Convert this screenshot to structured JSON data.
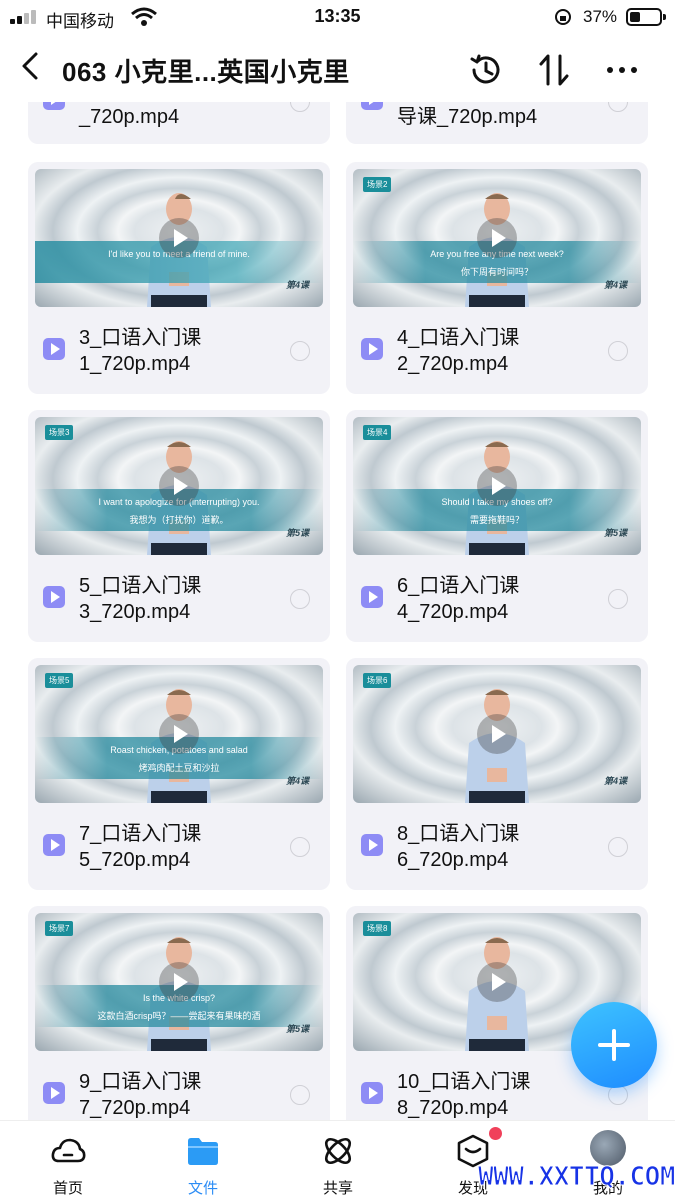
{
  "status_bar": {
    "carrier": "中国移动",
    "time": "13:35",
    "battery_percent_text": "37%",
    "battery_level": 0.37
  },
  "header": {
    "title": "063 小克里...英国小克里",
    "icons": [
      "back-chevron-icon",
      "history-icon",
      "sort-icon",
      "more-icon"
    ]
  },
  "files": [
    {
      "line1": "",
      "line2": "_720p.mp4",
      "partial": true
    },
    {
      "line1": "",
      "line2": "导课_720p.mp4",
      "partial": true
    },
    {
      "line1": "3_口语入门课",
      "line2": "1_720p.mp4",
      "sub_en": "I'd like you to meet a friend of mine.",
      "sub_zh": "",
      "lesson": "第4课",
      "tag": ""
    },
    {
      "line1": "4_口语入门课",
      "line2": "2_720p.mp4",
      "sub_en": "Are you free any time next week?",
      "sub_zh": "你下周有时间吗？",
      "lesson": "第4课",
      "tag": "场景2"
    },
    {
      "line1": "5_口语入门课",
      "line2": "3_720p.mp4",
      "sub_en": "I want to apologize for (interrupting) you.",
      "sub_zh": "我想为（打扰你）道歉。",
      "lesson": "第5课",
      "tag": "场景3"
    },
    {
      "line1": "6_口语入门课",
      "line2": "4_720p.mp4",
      "sub_en": "Should I take my shoes off?",
      "sub_zh": "需要拖鞋吗？",
      "lesson": "第5课",
      "tag": "场景4"
    },
    {
      "line1": "7_口语入门课",
      "line2": "5_720p.mp4",
      "sub_en": "Roast chicken, potatoes and salad",
      "sub_zh": "烤鸡肉配土豆和沙拉",
      "lesson": "第4课",
      "tag": "场景5"
    },
    {
      "line1": "8_口语入门课",
      "line2": "6_720p.mp4",
      "sub_en": "",
      "sub_zh": "",
      "lesson": "第4课",
      "tag": "场景6"
    },
    {
      "line1": "9_口语入门课",
      "line2": "7_720p.mp4",
      "sub_en": "Is the white crisp?",
      "sub_zh": "这款白酒crisp吗？——尝起来有果味的酒",
      "lesson": "第5课",
      "tag": "场景7"
    },
    {
      "line1": "10_口语入门课",
      "line2": "8_720p.mp4",
      "sub_en": "",
      "sub_zh": "",
      "lesson": "",
      "tag": "场景8"
    }
  ],
  "tabs": [
    {
      "label": "首页",
      "icon": "cloud-home-icon",
      "active": false
    },
    {
      "label": "文件",
      "icon": "folder-icon",
      "active": true
    },
    {
      "label": "共享",
      "icon": "share-atom-icon",
      "active": false
    },
    {
      "label": "发现",
      "icon": "discover-box-icon",
      "active": false
    },
    {
      "label": "我的",
      "icon": "avatar-icon",
      "active": false
    }
  ],
  "watermark": "WWW.XXTTQ.COM",
  "colors": {
    "accent": "#2b8cf5",
    "card_bg": "#f2f2f7",
    "file_icon": "#8e8cf5",
    "fab": "#1e8cff",
    "badge": "#f0405a"
  }
}
